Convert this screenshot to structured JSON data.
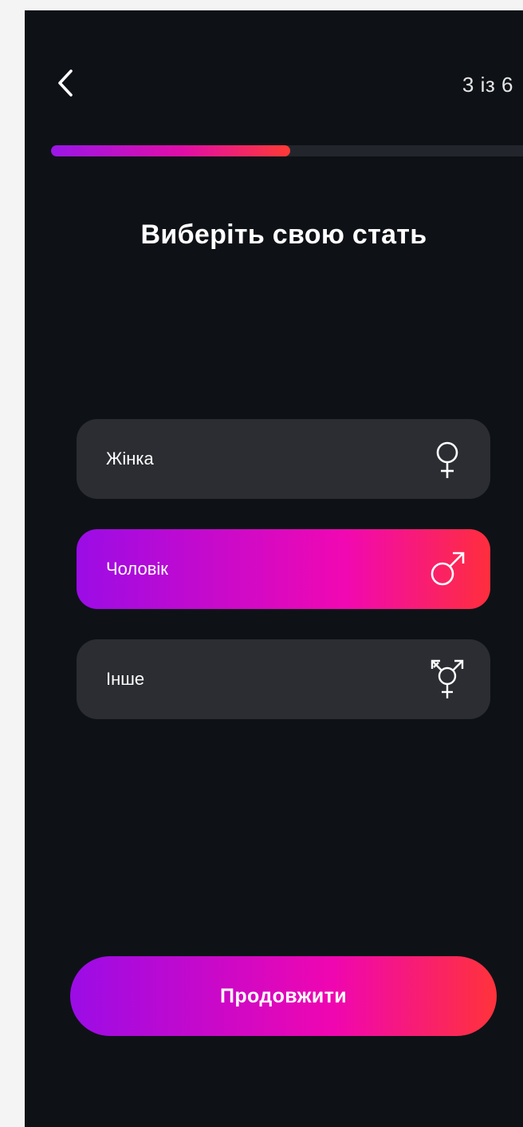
{
  "header": {
    "back_icon": "chevron-left-icon",
    "step_counter": "3 із 6"
  },
  "progress": {
    "fraction": 0.5,
    "gradient_colors": [
      "#9a16e8",
      "#e00ea8",
      "#ff3a35"
    ]
  },
  "question": {
    "title": "Виберіть свою стать"
  },
  "options": [
    {
      "label": "Жінка",
      "icon": "female-symbol-icon",
      "selected": false
    },
    {
      "label": "Чоловік",
      "icon": "male-symbol-icon",
      "selected": true
    },
    {
      "label": "Інше",
      "icon": "transgender-symbol-icon",
      "selected": false
    }
  ],
  "footer": {
    "continue_label": "Продовжити"
  },
  "colors": {
    "background": "#0e1217",
    "option_background": "#2b2d32",
    "accent_gradient": [
      "#9b0ce6",
      "#f108b2",
      "#ff2e3c"
    ]
  }
}
